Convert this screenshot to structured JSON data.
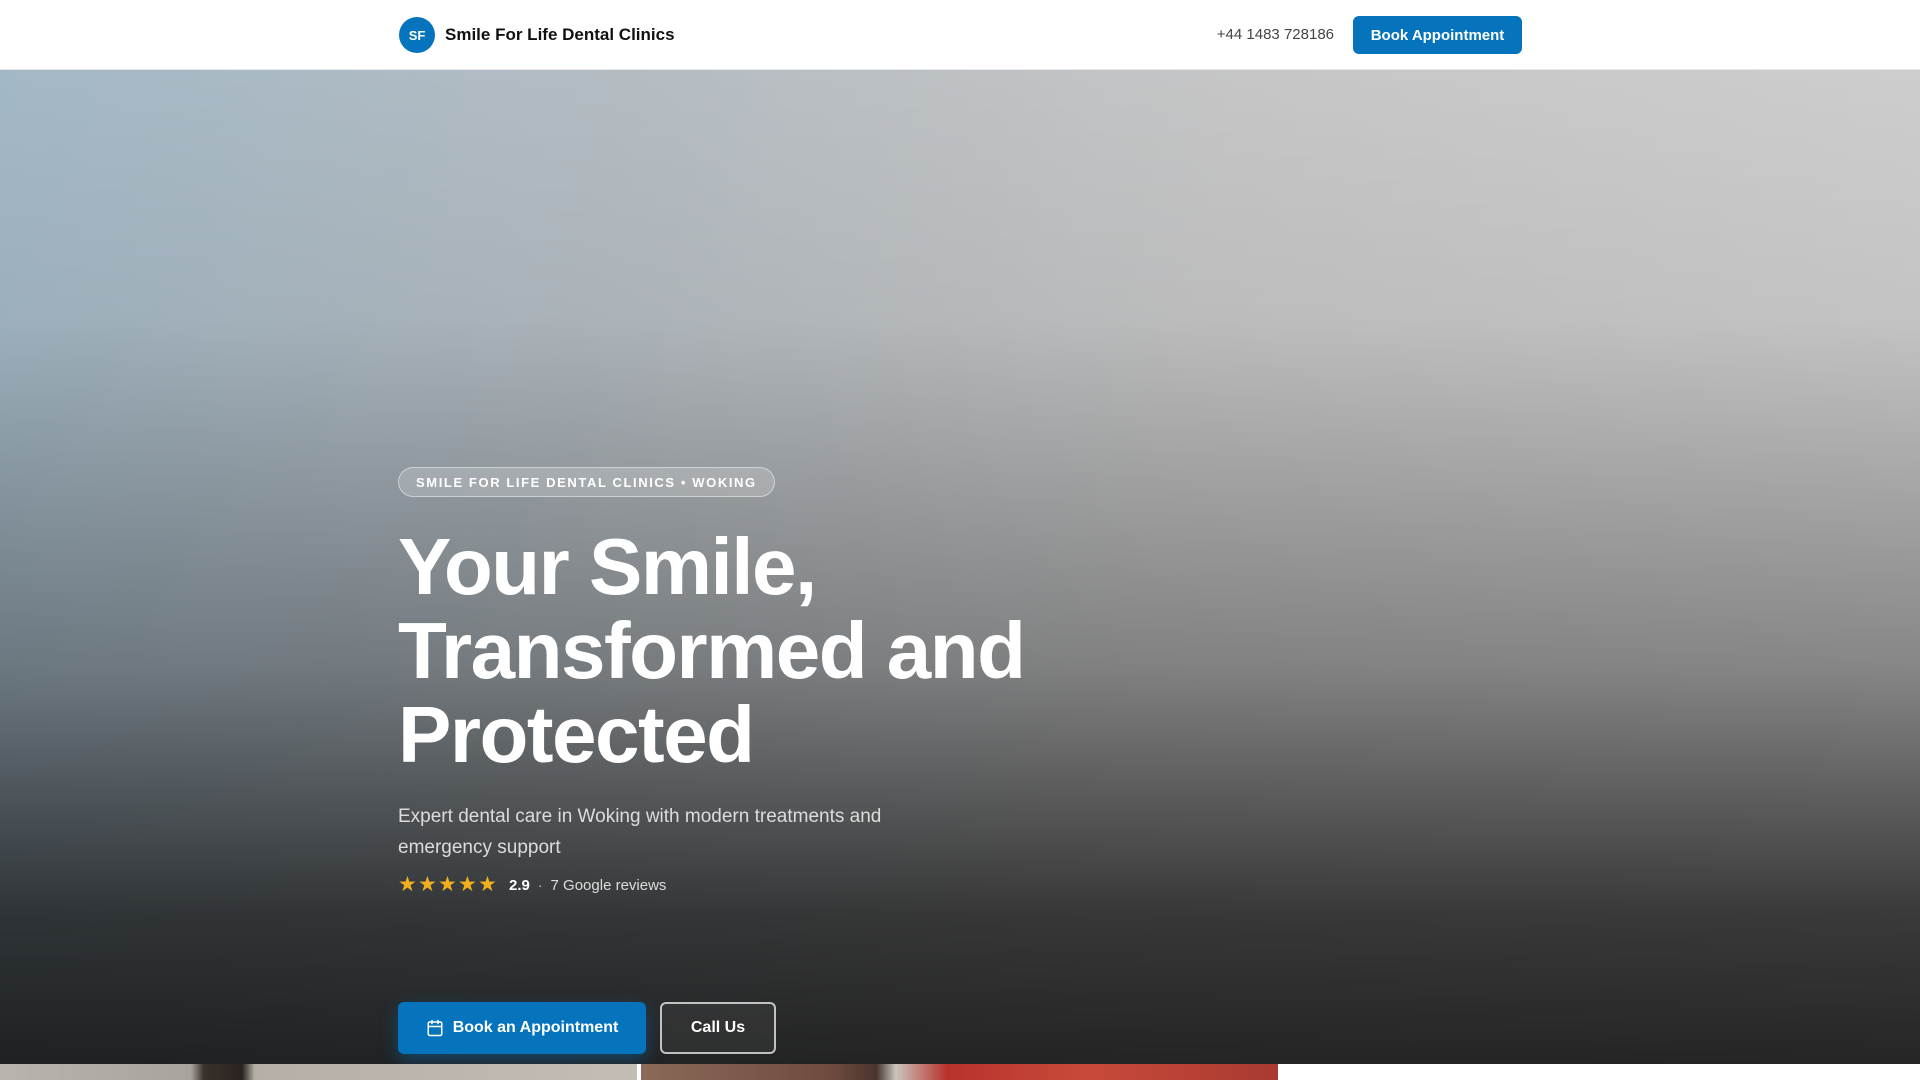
{
  "header": {
    "logo_initials": "SF",
    "brand_name": "Smile For Life Dental Clinics",
    "phone": "+44 1483 728186",
    "book_button": "Book Appointment"
  },
  "hero": {
    "tag": "SMILE FOR LIFE DENTAL CLINICS • WOKING",
    "headline_lines": [
      "Your Smile,",
      "Transformed and",
      "Protected"
    ],
    "subtitle": "Expert dental care in Woking with modern treatments and emergency support",
    "rating": {
      "stars": "★★★★★",
      "value": "2.9",
      "separator": "·",
      "reviews": "7 Google reviews"
    },
    "primary_cta": "Book an Appointment",
    "secondary_cta": "Call Us"
  },
  "colors": {
    "accent": "#0674bd",
    "star": "#f2b01e"
  },
  "icons": {
    "calendar": "calendar-icon"
  }
}
